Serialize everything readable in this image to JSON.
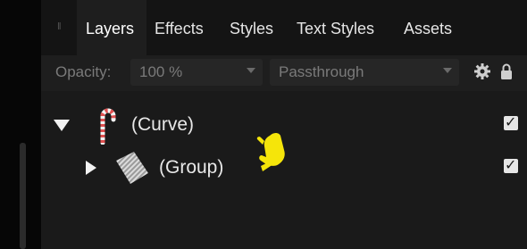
{
  "tabs": [
    {
      "label": "Layers",
      "active": true
    },
    {
      "label": "Effects"
    },
    {
      "label": "Styles"
    },
    {
      "label": "Text Styles"
    },
    {
      "label": "Assets"
    }
  ],
  "toolbar": {
    "opacity_label": "Opacity:",
    "opacity_value": "100 %",
    "blend_mode_value": "Passthrough",
    "settings_icon": "gear-icon",
    "lock_icon": "lock-icon"
  },
  "layers": [
    {
      "name": "(Curve)",
      "expanded": true,
      "visible": true,
      "icon": "candy-cane-curve-thumbnail"
    },
    {
      "name": "(Group)",
      "expanded": false,
      "visible": true,
      "icon": "pattern-group-thumbnail"
    }
  ],
  "colors": {
    "panel_bg": "#1e1e1e",
    "tabbar_bg": "#141414",
    "text": "#e6e6e6",
    "muted_text": "#7a7a7a",
    "cursor_yellow": "#f5e50a"
  }
}
